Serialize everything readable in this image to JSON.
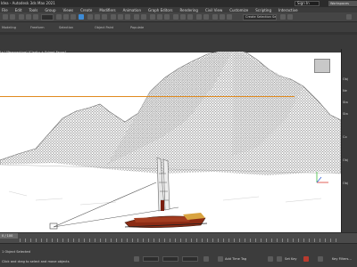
{
  "app": {
    "title": "Idea - Autodesk 3ds Max 2021",
    "sign_in": "Sign In",
    "workspaces": "Workspaces"
  },
  "menu": [
    "File",
    "Edit",
    "Tools",
    "Group",
    "Views",
    "Create",
    "Modifiers",
    "Animation",
    "Graph Editors",
    "Rendering",
    "Civil View",
    "Customize",
    "Scripting",
    "Interactive"
  ],
  "toolbar": {
    "selection_set": "Create Selection Se"
  },
  "ribbon_tabs": [
    "Modeling",
    "Freeform",
    "Selection",
    "Object Paint",
    "Populate"
  ],
  "viewport": {
    "label": "[+] [Perspective] [Clarity + Edged Faces]"
  },
  "command_panel": {
    "items": [
      "Obj",
      "Ne",
      "Sta",
      "Sta",
      "Co",
      "Obj",
      "Obj"
    ]
  },
  "timeline": {
    "frame": "0 / 100"
  },
  "status": {
    "selected": "1 Object Selected",
    "hint": "Click and drag to select and move objects",
    "add_time_tag": "Add Time Tag",
    "set_key": "Set Key",
    "key_filters": "Key Filters..."
  },
  "colors": {
    "accent": "#3d8bd6",
    "orange_grid": "#e08a1e",
    "wireframe": "#9a9a9a",
    "boat": "#8b2b14"
  }
}
